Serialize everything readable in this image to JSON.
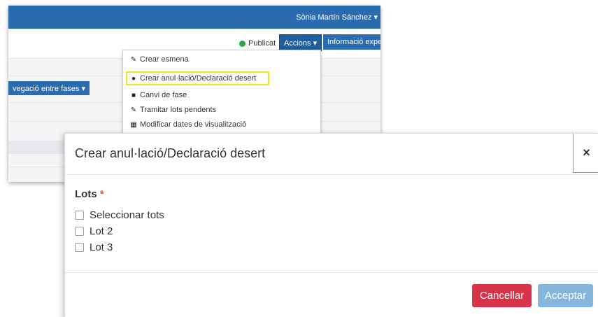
{
  "background": {
    "user_name": "Sònia Martín Sánchez ▾",
    "status": {
      "label": "Publicat",
      "color": "#27a844"
    },
    "accions_button": "Accions ▾",
    "info_button": "Informació expe",
    "nav_button": "vegació entre fases ▾",
    "dropdown": {
      "items": [
        {
          "icon": "edit-icon",
          "label": "Crear esmena"
        },
        {
          "icon": "circle-x-icon",
          "label": "Crear anul·lació/Declaració desert",
          "highlighted": true
        },
        {
          "icon": "copy-icon",
          "label": "Canvi de fase"
        },
        {
          "icon": "edit-icon",
          "label": "Tramitar lots pendents"
        },
        {
          "icon": "calendar-icon",
          "label": "Modificar dates de visualització"
        }
      ]
    }
  },
  "modal": {
    "title": "Crear anul·lació/Declaració desert",
    "close_symbol": "×",
    "lots_label": "Lots",
    "required_mark": "*",
    "options": [
      {
        "label": "Seleccionar tots",
        "checked": false
      },
      {
        "label": "Lot 2",
        "checked": false
      },
      {
        "label": "Lot 3",
        "checked": false
      }
    ],
    "cancel_label": "Cancellar",
    "accept_label": "Acceptar"
  },
  "colors": {
    "navbar": "#2b6cb1",
    "highlight": "#f2e41c",
    "cancel": "#d9334a",
    "accept": "#85b5dd"
  }
}
